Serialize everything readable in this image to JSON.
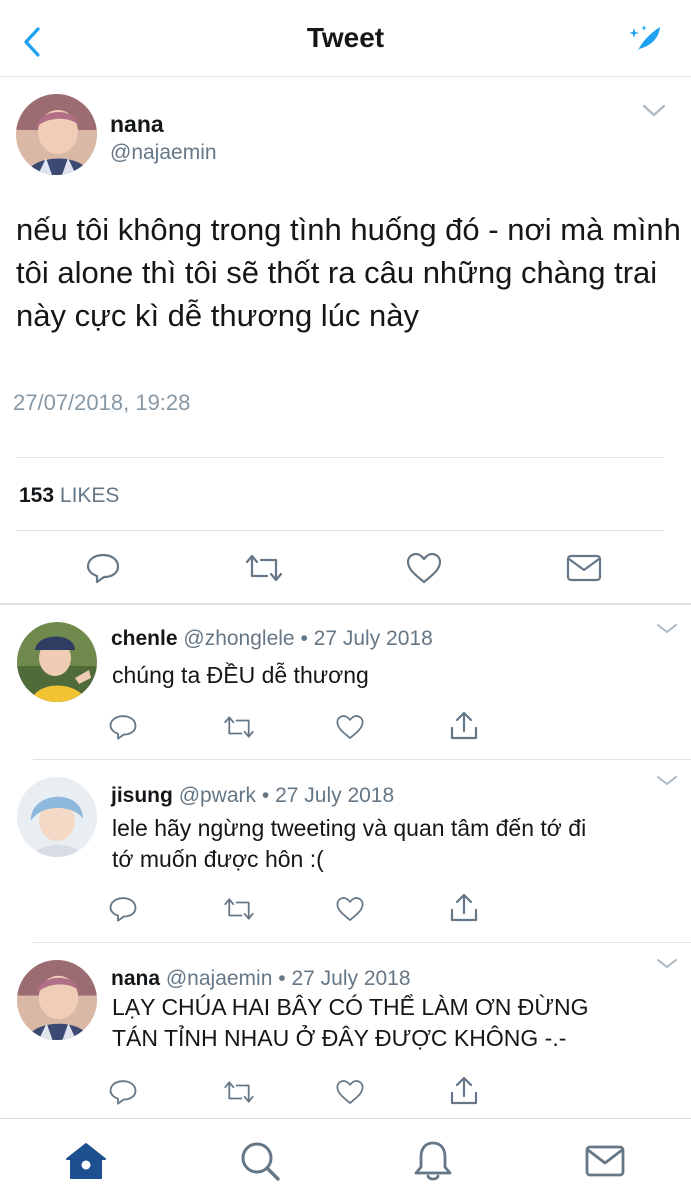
{
  "header": {
    "title": "Tweet"
  },
  "tweet": {
    "name": "nana",
    "handle": "@najaemin",
    "text": "nếu tôi không trong tình huống đó - nơi mà mình tôi alone thì tôi sẽ thốt ra câu những chàng trai này cực kì dễ thương lúc này",
    "timestamp": "27/07/2018, 19:28",
    "likes_count": "153",
    "likes_label": "LIKES"
  },
  "replies": [
    {
      "name": "chenle",
      "handle": "@zhonglele",
      "sep": "•",
      "date": "27 July 2018",
      "text": "chúng ta ĐỀU dễ thương"
    },
    {
      "name": "jisung",
      "handle": "@pwark",
      "sep": "•",
      "date": "27 July 2018",
      "text": "lele hãy ngừng tweeting và quan tâm đến tớ đi\ntớ muốn được hôn :("
    },
    {
      "name": "nana",
      "handle": "@najaemin",
      "sep": "•",
      "date": "27 July 2018",
      "text": "LẠY CHÚA HAI BÂY CÓ THỂ LÀM ƠN ĐỪNG\nTÁN TỈNH NHAU Ở ĐÂY ĐƯỢC KHÔNG -.-"
    }
  ],
  "colors": {
    "accent": "#1da1f2",
    "muted": "#657786",
    "home_active": "#1d4f91"
  },
  "icons": {
    "header": [
      "back-chevron-icon",
      "sparkle-feather-icon"
    ],
    "actions": [
      "reply-icon",
      "retweet-icon",
      "like-icon",
      "message-icon"
    ],
    "reply_actions": [
      "reply-icon",
      "retweet-icon",
      "like-icon",
      "share-icon"
    ],
    "tab_bar": [
      "home-icon",
      "search-icon",
      "notifications-icon",
      "messages-icon"
    ]
  }
}
